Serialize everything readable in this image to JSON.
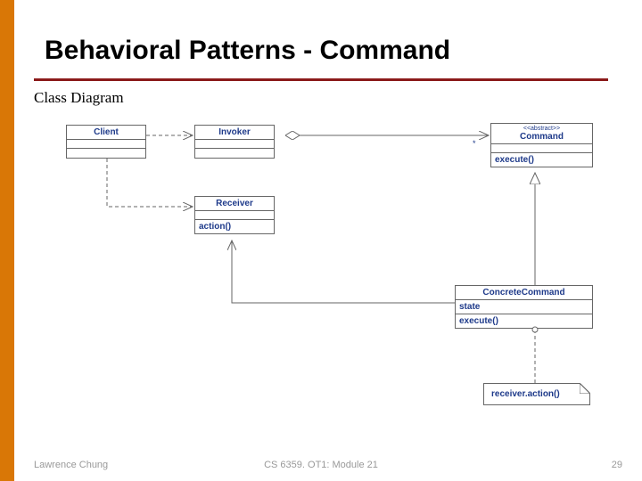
{
  "title": "Behavioral Patterns - Command",
  "subtitle": "Class Diagram",
  "classes": {
    "client": {
      "name": "Client"
    },
    "invoker": {
      "name": "Invoker"
    },
    "command": {
      "stereo": "<<abstract>>",
      "name": "Command",
      "op": "execute()"
    },
    "receiver": {
      "name": "Receiver",
      "op": "action()"
    },
    "concrete": {
      "name": "ConcreteCommand",
      "attr": "state",
      "op": "execute()"
    }
  },
  "multiplicity": "*",
  "note": "receiver.action()",
  "footer": {
    "left": "Lawrence Chung",
    "center": "CS 6359. OT1: Module 21",
    "right": "29"
  },
  "chart_data": {
    "type": "table",
    "diagram": "UML Class Diagram — Command Pattern",
    "classes": [
      {
        "name": "Client",
        "attributes": [],
        "operations": []
      },
      {
        "name": "Invoker",
        "attributes": [],
        "operations": []
      },
      {
        "name": "Command",
        "stereotype": "abstract",
        "attributes": [],
        "operations": [
          "execute()"
        ]
      },
      {
        "name": "Receiver",
        "attributes": [],
        "operations": [
          "action()"
        ]
      },
      {
        "name": "ConcreteCommand",
        "attributes": [
          "state"
        ],
        "operations": [
          "execute()"
        ]
      }
    ],
    "relationships": [
      {
        "from": "Client",
        "to": "Invoker",
        "kind": "dependency"
      },
      {
        "from": "Client",
        "to": "Receiver",
        "kind": "dependency"
      },
      {
        "from": "Invoker",
        "to": "Command",
        "kind": "aggregation",
        "multiplicity": "*"
      },
      {
        "from": "ConcreteCommand",
        "to": "Command",
        "kind": "generalization"
      },
      {
        "from": "ConcreteCommand",
        "to": "Receiver",
        "kind": "association"
      },
      {
        "from": "ConcreteCommand",
        "to": "note",
        "kind": "note-link",
        "note": "receiver.action()"
      }
    ]
  }
}
